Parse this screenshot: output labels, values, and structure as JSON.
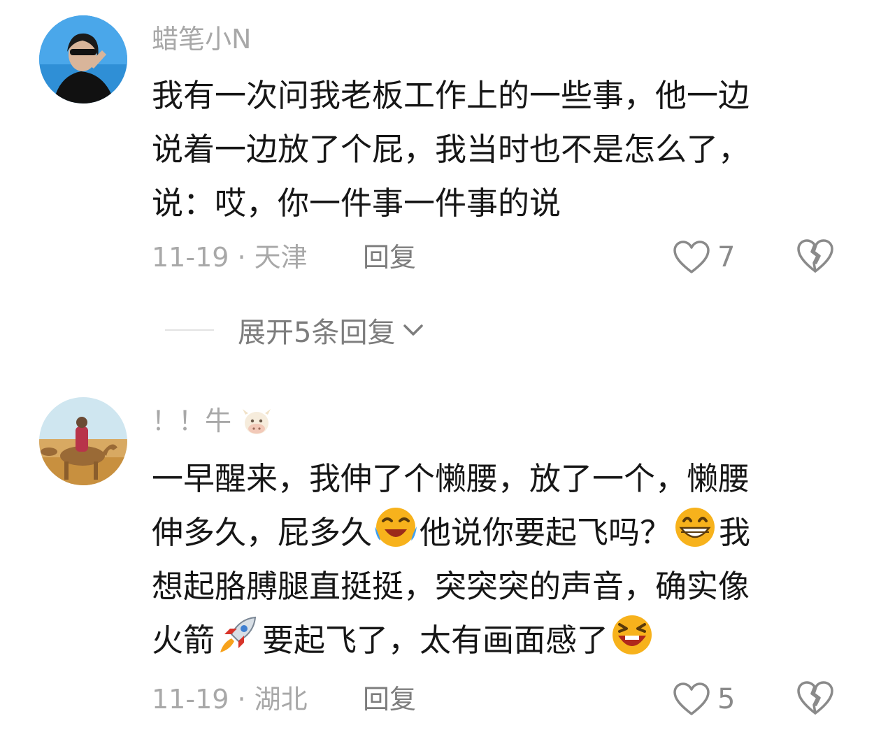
{
  "comments": [
    {
      "username": "蜡笔小N",
      "lines": [
        "我有一次问我老板工作上的一些事，他一边",
        "说着一边放了个屁，我当时也不是怎么了，",
        "说：哎，你一件事一件事的说"
      ],
      "meta": "11-19 · 天津",
      "reply_label": "回复",
      "likes": "7",
      "expand_label": "展开5条回复"
    },
    {
      "username": "！！牛",
      "username_emoji": "cow-face-emoji",
      "lines": [
        [
          "一早醒来，我伸了个懒腰，放了一个，懒腰"
        ],
        [
          "伸多久，屁多久",
          "他说你要起飞吗？",
          "我"
        ],
        [
          "想起胳膊腿直挺挺，突突突的声音，确实像"
        ],
        [
          "火箭",
          "要起飞了，太有画面感了"
        ]
      ],
      "emojis": [
        "face-with-tears-of-joy-emoji",
        "grinning-face-emoji",
        "rocket-emoji",
        "laughing-face-emoji"
      ],
      "meta": "11-19 · 湖北",
      "reply_label": "回复",
      "likes": "5"
    }
  ],
  "colors": {
    "text": "#161616",
    "muted": "#a8a8a8",
    "reply": "#7d7d7d"
  }
}
